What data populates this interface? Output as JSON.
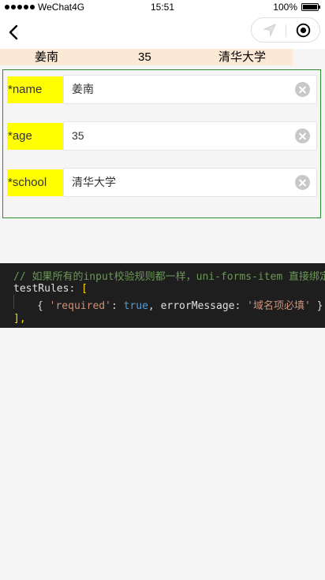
{
  "status_bar": {
    "carrier": "WeChat4G",
    "time": "15:51",
    "battery_percent": "100%",
    "battery_level": 1.0
  },
  "nav": {
    "back_icon": "chevron-left-icon",
    "location_icon": "location-arrow-icon",
    "record_icon": "target-icon"
  },
  "info_row": {
    "name": "姜南",
    "age": "35",
    "school": "清华大学",
    "background": "#fbe9d6"
  },
  "form": {
    "fields": [
      {
        "label": "*name",
        "value": "姜南"
      },
      {
        "label": "*age",
        "value": "35"
      },
      {
        "label": "*school",
        "value": "清华大学"
      }
    ],
    "label_background": "#ffff00",
    "border_color": "#2e8b2e"
  },
  "code": {
    "line1_comment": "// 如果所有的input校验规则都一样，uni-forms-item 直接绑定",
    "line2_key": "testRules",
    "line2_colon": ": ",
    "line2_bracket": "[",
    "line3_open": "{ ",
    "line3_key1": "'required'",
    "line3_colon1": ": ",
    "line3_val1": "true",
    "line3_comma": ", ",
    "line3_key2": "errorMessage",
    "line3_colon2": ": ",
    "line3_val2": "'域名项必填'",
    "line3_close": " }",
    "line4_close": "],"
  }
}
